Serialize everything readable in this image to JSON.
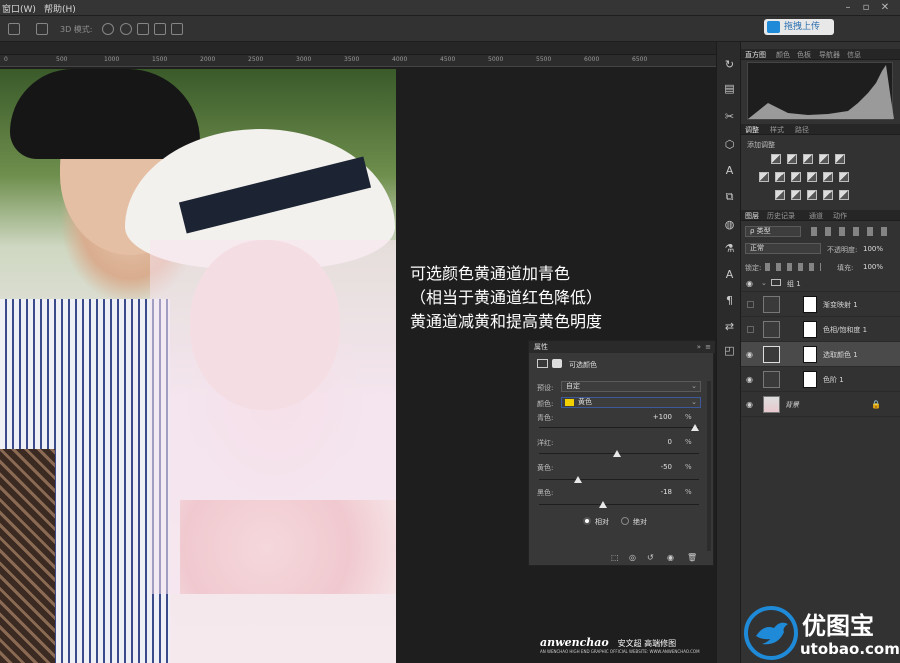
{
  "menu": {
    "window": "窗口(W)",
    "help": "帮助(H)"
  },
  "options": {
    "mode3d": "3D 模式:",
    "upload": "拖拽上传"
  },
  "ruler_ticks": [
    "0",
    "500",
    "1000",
    "1500",
    "2000",
    "2500",
    "3000",
    "3500",
    "4000",
    "4500",
    "5000",
    "5500",
    "6000",
    "6500"
  ],
  "overlay_text": [
    "可选颜色黄通道加青色",
    "（相当于黄通道红色降低）",
    "黄通道减黄和提高黄色明度"
  ],
  "watermark": {
    "brand": "anwenchao",
    "name": "安文超 高端修图",
    "sub": "AN WENCHAO HIGH END GRAPHIC OFFICIAL WEBSITE: WWW.ANWENCHAO.COM"
  },
  "top_tabs": [
    "直方图",
    "颜色",
    "色板",
    "导航器",
    "信息"
  ],
  "adjust_tabs": [
    "调整",
    "样式",
    "路径"
  ],
  "adjust_add": "添加调整",
  "layers_tabs": [
    "图层",
    "历史记录",
    "通道",
    "动作"
  ],
  "layers_filter": "ρ 类型",
  "blend_mode": "正常",
  "opacity": {
    "label": "不透明度:",
    "value": "100%"
  },
  "lock": {
    "label": "锁定:",
    "fill_label": "填充:",
    "fill_value": "100%"
  },
  "group_name": "组 1",
  "layers": [
    {
      "name": "渐变映射 1",
      "visible": false
    },
    {
      "name": "色相/饱和度 1",
      "visible": false
    },
    {
      "name": "选取颜色 1",
      "visible": true,
      "selected": true
    },
    {
      "name": "色阶 1",
      "visible": true
    },
    {
      "name": "背景",
      "visible": true
    }
  ],
  "properties": {
    "title": "属性",
    "subtitle": "可选颜色",
    "preset_label": "预设:",
    "preset_value": "自定",
    "color_label": "颜色:",
    "color_value": "黄色",
    "color_swatch": "#f2d000",
    "sliders": [
      {
        "label": "青色:",
        "value": "+100",
        "unit": "%",
        "level": 100
      },
      {
        "label": "洋红:",
        "value": "0",
        "unit": "%",
        "level": 0
      },
      {
        "label": "黄色:",
        "value": "-50",
        "unit": "%",
        "level": -50
      },
      {
        "label": "黑色:",
        "value": "-18",
        "unit": "%",
        "level": -18
      }
    ],
    "method_relative": "相对",
    "method_absolute": "绝对"
  },
  "logo": {
    "title": "优图宝",
    "url": "utobao.com"
  }
}
